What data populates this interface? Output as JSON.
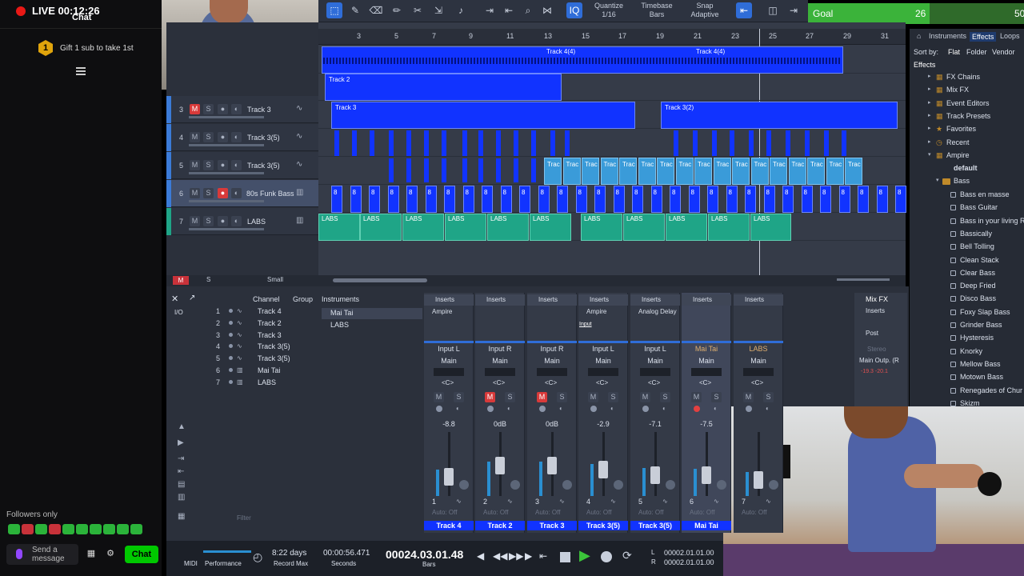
{
  "stream": {
    "live_label": "LIVE 00:12:26",
    "chat_title": "Chat",
    "gift_badge": "1",
    "gift_text": "Gift 1 sub to take 1st",
    "followers_only": "Followers only",
    "send_message": "Send a message",
    "chat_button": "Chat"
  },
  "goal": {
    "label": "Goal",
    "current": "26",
    "total": "50",
    "progress_fraction": 0.52
  },
  "toolbar": {
    "quantize_label": "Quantize",
    "quantize_value": "1/16",
    "timebase_label": "Timebase",
    "timebase_value": "Bars",
    "snap_label": "Snap",
    "snap_value": "Adaptive",
    "iq_label": "IQ"
  },
  "ruler": [
    "3",
    "5",
    "7",
    "9",
    "11",
    "13",
    "15",
    "17",
    "19",
    "21",
    "23",
    "25",
    "27",
    "29",
    "31"
  ],
  "tracks": [
    {
      "num": "3",
      "name": "Track 3"
    },
    {
      "num": "4",
      "name": "Track 3(5)"
    },
    {
      "num": "5",
      "name": "Track 3(5)"
    },
    {
      "num": "6",
      "name": "80s Funk Bass"
    },
    {
      "num": "7",
      "name": "LABS"
    }
  ],
  "clips": {
    "track4a": "Track 4(4)",
    "track4b": "Track 4(4)",
    "track2": "Track 2",
    "track3": "Track 3",
    "track3_2": "Track 3(2)",
    "trac": "Trac",
    "trac_last": "Trac",
    "bass": "8",
    "labs": "LABS"
  },
  "arrange_footer": {
    "m": "M",
    "s": "S",
    "size": "Small"
  },
  "browser": {
    "tabs": [
      "Instruments",
      "Effects",
      "Loops"
    ],
    "sort_by": "Sort by:",
    "sort_options": [
      "Flat",
      "Folder",
      "Vendor"
    ],
    "breadcrumb": "Effects",
    "items": [
      "FX Chains",
      "Mix FX",
      "Event Editors",
      "Track Presets",
      "Favorites",
      "Recent",
      "Ampire"
    ],
    "default": "default",
    "bass_folder": "Bass",
    "presets": [
      "Bass en masse",
      "Bass Guitar",
      "Bass in your living R",
      "Bassically",
      "Bell Tolling",
      "Clean Stack",
      "Clear Bass",
      "Deep Fried",
      "Disco Bass",
      "Foxy Slap Bass",
      "Grinder Bass",
      "Hysteresis",
      "Knorky",
      "Mellow Bass",
      "Motown Bass",
      "Renegades of Chur",
      "Skizm"
    ]
  },
  "console": {
    "channel_tab": "Channel",
    "group_tab": "Group",
    "instruments_tab": "Instruments",
    "io": "I/O",
    "channels": [
      {
        "num": "1",
        "name": "Track 4"
      },
      {
        "num": "2",
        "name": "Track 2"
      },
      {
        "num": "3",
        "name": "Track 3"
      },
      {
        "num": "4",
        "name": "Track 3(5)"
      },
      {
        "num": "5",
        "name": "Track 3(5)"
      },
      {
        "num": "6",
        "name": "Mai Tai"
      },
      {
        "num": "7",
        "name": "LABS"
      }
    ],
    "instruments": [
      "Mai Tai",
      "LABS"
    ],
    "filter": "Filter",
    "inserts_label": "Inserts",
    "mixfx": "Mix FX",
    "post": "Post",
    "stereo": "Stereo",
    "main_out": "Main Outp. (R",
    "main_vals": "-19.3  -20.1",
    "input_badge": "Input",
    "strips": [
      {
        "insert": "Ampire",
        "io": "Input L",
        "out": "Main",
        "db": "-8.8",
        "num": "1",
        "label": "Track 4",
        "fader": 0.55
      },
      {
        "insert": "",
        "io": "Input R",
        "out": "Main",
        "db": "0dB",
        "num": "2",
        "label": "Track 2",
        "fader": 0.72
      },
      {
        "insert": "",
        "io": "Input R",
        "out": "Main",
        "db": "0dB",
        "num": "3",
        "label": "Track 3",
        "fader": 0.72
      },
      {
        "insert": "Ampire",
        "io": "Input L",
        "out": "Main",
        "db": "-2.9",
        "num": "4",
        "label": "Track 3(5)",
        "fader": 0.66
      },
      {
        "insert": "Analog Delay",
        "io": "Input L",
        "out": "Main",
        "db": "-7.1",
        "num": "5",
        "label": "Track 3(5)",
        "fader": 0.58
      },
      {
        "insert": "",
        "io": "Mai Tai",
        "out": "Main",
        "db": "-7.5",
        "num": "6",
        "label": "Mai Tai",
        "fader": 0.57
      },
      {
        "insert": "",
        "io": "LABS",
        "out": "Main",
        "db": "",
        "num": "7",
        "label": "",
        "fader": 0.5
      }
    ],
    "auto_off": "Auto: Off"
  },
  "transport": {
    "midi": "MIDI",
    "performance": "Performance",
    "days": "8:22 days",
    "record_max": "Record Max",
    "seconds_time": "00:00:56.471",
    "seconds_label": "Seconds",
    "bars_time": "00024.03.01.48",
    "bars_label": "Bars",
    "l_pos": "00002.01.01.00",
    "r_pos": "00002.01.01.00"
  },
  "colors": {
    "clip_blue": "#1133ff",
    "clip_lightblue": "#3a9bd9",
    "clip_teal": "#1fa587",
    "goal_green": "#3bb33a",
    "live_red": "#e91916"
  }
}
